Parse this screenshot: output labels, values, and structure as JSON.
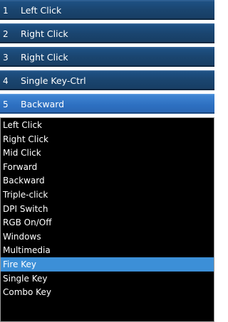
{
  "buttons": [
    {
      "number": "1",
      "label": "Left Click"
    },
    {
      "number": "2",
      "label": "Right Click"
    },
    {
      "number": "3",
      "label": "Right Click"
    },
    {
      "number": "4",
      "label": "Single Key-Ctrl"
    },
    {
      "number": "5",
      "label": "Backward"
    }
  ],
  "selected_button": "5",
  "dropdown": {
    "options": [
      "Left Click",
      "Right Click",
      "Mid Click",
      "Forward",
      "Backward",
      "Triple-click",
      "DPI Switch",
      "RGB On/Off",
      "Windows",
      "Multimedia",
      "Fire Key",
      "Single Key",
      "Combo Key"
    ],
    "highlighted_option": "Fire Key"
  },
  "colors": {
    "row_background": "#1a456f",
    "selected_row_background": "#2d6fc0",
    "dropdown_background": "#000000",
    "dropdown_highlight": "#3c8fd7",
    "text": "#ffffff"
  }
}
